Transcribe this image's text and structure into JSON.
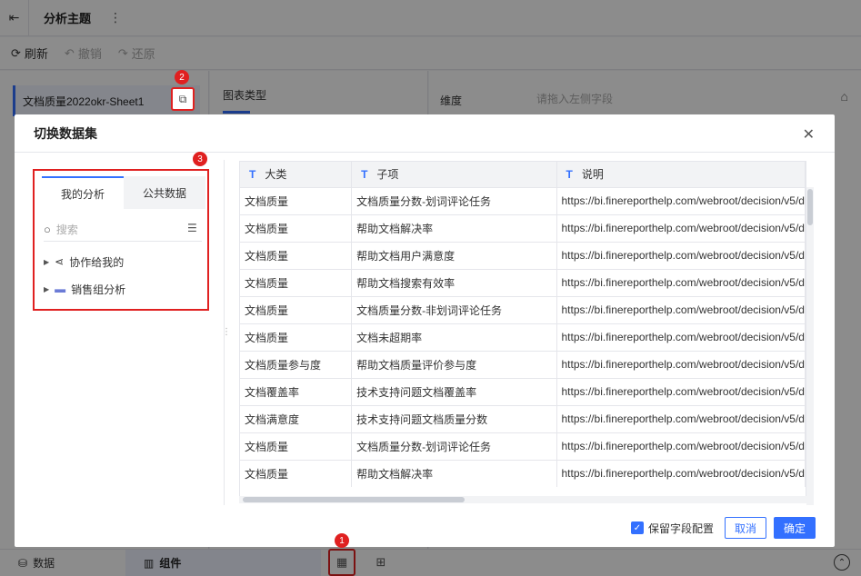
{
  "app": {
    "title": "分析主题"
  },
  "toolbar": {
    "refresh": "刷新",
    "undo": "撤销",
    "redo": "还原"
  },
  "left": {
    "dataset_name": "文档质量2022okr-Sheet1"
  },
  "middle": {
    "chart_type_label": "图表类型"
  },
  "right": {
    "dimension_label": "维度",
    "dimension_placeholder": "请拖入左侧字段"
  },
  "bottom": {
    "data_tab": "数据",
    "component_tab": "组件"
  },
  "badges": {
    "one": "1",
    "two": "2",
    "three": "3"
  },
  "modal": {
    "title": "切换数据集",
    "tabs": {
      "mine": "我的分析",
      "public": "公共数据"
    },
    "search_placeholder": "搜索",
    "tree": [
      {
        "label": "协作给我的"
      },
      {
        "label": "销售组分析"
      }
    ],
    "table": {
      "headers": [
        "大类",
        "子项",
        "说明"
      ],
      "rows": [
        [
          "文档质量",
          "文档质量分数-划词评论任务",
          "https://bi.finereporthelp.com/webroot/decision/v5/d"
        ],
        [
          "文档质量",
          "帮助文档解决率",
          "https://bi.finereporthelp.com/webroot/decision/v5/d"
        ],
        [
          "文档质量",
          "帮助文档用户满意度",
          "https://bi.finereporthelp.com/webroot/decision/v5/d"
        ],
        [
          "文档质量",
          "帮助文档搜索有效率",
          "https://bi.finereporthelp.com/webroot/decision/v5/d"
        ],
        [
          "文档质量",
          "文档质量分数-非划词评论任务",
          "https://bi.finereporthelp.com/webroot/decision/v5/d"
        ],
        [
          "文档质量",
          "文档未超期率",
          "https://bi.finereporthelp.com/webroot/decision/v5/d"
        ],
        [
          "文档质量参与度",
          "帮助文档质量评价参与度",
          "https://bi.finereporthelp.com/webroot/decision/v5/d"
        ],
        [
          "文档覆盖率",
          "技术支持问题文档覆盖率",
          "https://bi.finereporthelp.com/webroot/decision/v5/d"
        ],
        [
          "文档满意度",
          "技术支持问题文档质量分数",
          "https://bi.finereporthelp.com/webroot/decision/v5/d"
        ],
        [
          "文档质量",
          "文档质量分数-划词评论任务",
          "https://bi.finereporthelp.com/webroot/decision/v5/d"
        ],
        [
          "文档质量",
          "帮助文档解决率",
          "https://bi.finereporthelp.com/webroot/decision/v5/d"
        ]
      ]
    },
    "keep_fields_label": "保留字段配置",
    "cancel": "取消",
    "confirm": "确定"
  },
  "colors": {
    "accent": "#3370ff",
    "highlight": "#e02020"
  }
}
